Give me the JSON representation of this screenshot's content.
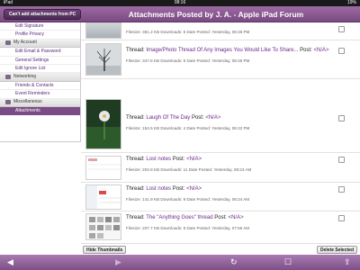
{
  "status_bar": {
    "carrier": "iPad",
    "time": "08:16",
    "battery": "19%"
  },
  "header": {
    "button_label": "Can't add attachments from PC",
    "title": "Attachments Posted by J. A. - Apple iPad Forum"
  },
  "sidebar": {
    "items": [
      {
        "type": "link",
        "label": "Edit Signature"
      },
      {
        "type": "link",
        "label": "Profile Privacy"
      },
      {
        "type": "section",
        "label": "My Account",
        "icon": "user-icon"
      },
      {
        "type": "link",
        "label": "Edit Email & Password"
      },
      {
        "type": "link",
        "label": "General Settings"
      },
      {
        "type": "link",
        "label": "Edit Ignore List"
      },
      {
        "type": "section",
        "label": "Networking",
        "icon": "network-icon"
      },
      {
        "type": "link",
        "label": "Friends & Contacts"
      },
      {
        "type": "link",
        "label": "Event Reminders"
      },
      {
        "type": "section",
        "label": "Miscellaneous",
        "icon": "misc-icon"
      },
      {
        "type": "active",
        "label": "Attachments"
      }
    ]
  },
  "attachments": [
    {
      "thread_prefix": "",
      "thread_title": "",
      "post_label": "",
      "post_value": "",
      "filesize_label": "Filesize:",
      "filesize": "381.2 KB",
      "downloads_label": "Downloads:",
      "downloads": "8",
      "date_label": "Date Posted:",
      "date": "Yesterday, 08:26 PM",
      "thumb": "thumb-top"
    },
    {
      "thread_prefix": "Thread:",
      "thread_title": "Image/Photo Thread Of Any Images You Would Like To Share...",
      "post_label": "Post:",
      "post_value": "<N/A>",
      "filesize_label": "Filesize:",
      "filesize": "347.6 KB",
      "downloads_label": "Downloads:",
      "downloads": "8",
      "date_label": "Date Posted:",
      "date": "Yesterday, 08:26 PM",
      "thumb": "thumb-tree"
    },
    {
      "thread_prefix": "Thread:",
      "thread_title": "Laugh Of The Day",
      "post_label": "Post:",
      "post_value": "<N/A>",
      "filesize_label": "Filesize:",
      "filesize": "154.5 KB",
      "downloads_label": "Downloads:",
      "downloads": "4",
      "date_label": "Date Posted:",
      "date": "Yesterday, 06:22 PM",
      "thumb": "thumb-flower"
    },
    {
      "thread_prefix": "Thread:",
      "thread_title": "Lost notes",
      "post_label": "Post:",
      "post_value": "<N/A>",
      "filesize_label": "Filesize:",
      "filesize": "204.8 KB",
      "downloads_label": "Downloads:",
      "downloads": "11",
      "date_label": "Date Posted:",
      "date": "Yesterday, 08:24 AM",
      "thumb": "thumb-notes"
    },
    {
      "thread_prefix": "Thread:",
      "thread_title": "Lost notes",
      "post_label": "Post:",
      "post_value": "<N/A>",
      "filesize_label": "Filesize:",
      "filesize": "141.9 KB",
      "downloads_label": "Downloads:",
      "downloads": "9",
      "date_label": "Date Posted:",
      "date": "Yesterday, 08:24 AM",
      "thumb": "thumb-screenshot"
    },
    {
      "thread_prefix": "Thread:",
      "thread_title": "The \"Anything Goes\" thread",
      "post_label": "Post:",
      "post_value": "<N/A>",
      "filesize_label": "Filesize:",
      "filesize": "207.7 KB",
      "downloads_label": "Downloads:",
      "downloads": "8",
      "date_label": "Date Posted:",
      "date": "Yesterday, 07:56 AM",
      "thumb": "thumb-grid"
    }
  ],
  "bottom": {
    "hide_thumbnails": "Hide Thumbnails",
    "delete_selected": "Delete Selected"
  },
  "toolbar": {
    "back": "back-icon",
    "forward": "forward-icon",
    "refresh": "refresh-icon",
    "bookmark": "bookmark-icon",
    "share": "share-icon"
  },
  "colors": {
    "header": "#8a5a92",
    "link": "#6a2a8a",
    "active": "#7b4d86"
  }
}
